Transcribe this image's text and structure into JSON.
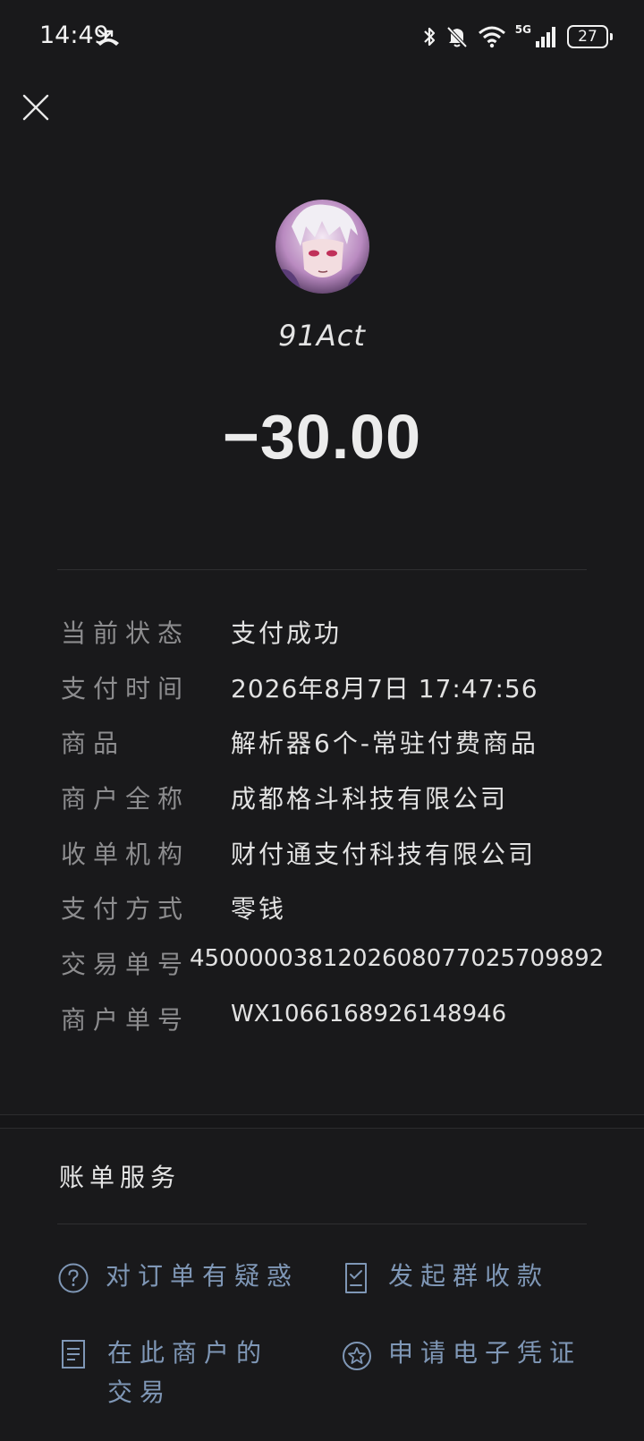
{
  "status_bar": {
    "time": "14:49",
    "network": "5G",
    "battery": "27",
    "icons": [
      "missed-call-icon",
      "bluetooth-icon",
      "mute-bell-icon",
      "wifi-icon",
      "signal-icon",
      "battery-icon"
    ]
  },
  "header": {
    "merchant_name": "91Act",
    "amount": "−30.00"
  },
  "details": [
    {
      "label": "当前状态",
      "value": "支付成功"
    },
    {
      "label": "支付时间",
      "value": "2026年8月7日 17:47:56"
    },
    {
      "label": "商品",
      "value": "解析器6个-常驻付费商品"
    },
    {
      "label": "商户全称",
      "value": "成都格斗科技有限公司"
    },
    {
      "label": "收单机构",
      "value": "财付通支付科技有限公司"
    },
    {
      "label": "支付方式",
      "value": "零钱"
    },
    {
      "label": "交易单号",
      "value": "4500000381202608077025709892"
    },
    {
      "label": "商户单号",
      "value": "WX1066168926148946"
    }
  ],
  "services": {
    "title": "账单服务",
    "items": [
      {
        "label": "对订单有疑惑",
        "icon": "question-circle-icon"
      },
      {
        "label": "发起群收款",
        "icon": "checklist-icon"
      },
      {
        "label": "在此商户的交易",
        "icon": "document-icon"
      },
      {
        "label": "申请电子凭证",
        "icon": "star-badge-icon"
      }
    ]
  },
  "colors": {
    "background": "#19191b",
    "label": "#8d8d8f",
    "link": "#7f97b6"
  }
}
